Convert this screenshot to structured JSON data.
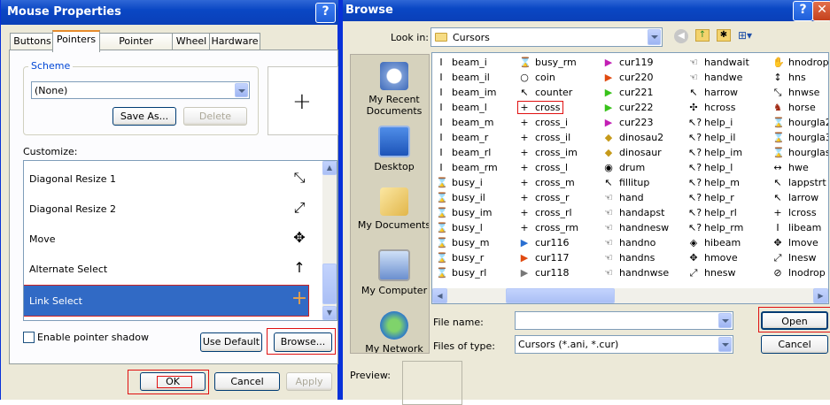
{
  "mouse": {
    "title": "Mouse Properties",
    "help_btn": "?",
    "tabs": [
      "Buttons",
      "Pointers",
      "Pointer Options",
      "Wheel",
      "Hardware"
    ],
    "scheme_label": "Scheme",
    "scheme_value": "(None)",
    "save_as": "Save As...",
    "delete": "Delete",
    "customize_label": "Customize:",
    "pointers": [
      {
        "label": "Diagonal Resize 1",
        "glyph": "⤡"
      },
      {
        "label": "Diagonal Resize 2",
        "glyph": "⤢"
      },
      {
        "label": "Move",
        "glyph": "✥"
      },
      {
        "label": "Alternate Select",
        "glyph": "↑"
      },
      {
        "label": "Link Select",
        "glyph": "+"
      }
    ],
    "shadow_label": "Enable pointer shadow",
    "use_default": "Use Default",
    "browse": "Browse...",
    "ok": "OK",
    "cancel": "Cancel",
    "apply": "Apply"
  },
  "browse": {
    "title": "Browse",
    "help_btn": "?",
    "close_btn": "✕",
    "look_in_label": "Look in:",
    "look_in_value": "Cursors",
    "places": [
      "My Recent Documents",
      "Desktop",
      "My Documents",
      "My Computer",
      "My Network"
    ],
    "col1": [
      "beam_i",
      "beam_il",
      "beam_im",
      "beam_l",
      "beam_m",
      "beam_r",
      "beam_rl",
      "beam_rm",
      "busy_i",
      "busy_il",
      "busy_im",
      "busy_l",
      "busy_m",
      "busy_r",
      "busy_rl"
    ],
    "col2": [
      "busy_rm",
      "coin",
      "counter",
      "cross",
      "cross_i",
      "cross_il",
      "cross_im",
      "cross_l",
      "cross_m",
      "cross_r",
      "cross_rl",
      "cross_rm",
      "cur116",
      "cur117",
      "cur118"
    ],
    "col3": [
      "cur119",
      "cur220",
      "cur221",
      "cur222",
      "cur223",
      "dinosau2",
      "dinosaur",
      "drum",
      "fillitup",
      "hand",
      "handapst",
      "handnesw",
      "handno",
      "handns",
      "handnwse"
    ],
    "col4": [
      "handwait",
      "handwe",
      "harrow",
      "hcross",
      "help_i",
      "help_il",
      "help_im",
      "help_l",
      "help_m",
      "help_r",
      "help_rl",
      "help_rm",
      "hibeam",
      "hmove",
      "hnesw"
    ],
    "col5": [
      "hnodrop",
      "hns",
      "hnwse",
      "horse",
      "hourgla2",
      "hourgla3",
      "hourglas",
      "hwe",
      "lappstrt",
      "larrow",
      "lcross",
      "libeam",
      "lmove",
      "lnesw",
      "lnodrop"
    ],
    "file_name_label": "File name:",
    "file_name_value": "",
    "files_of_type_label": "Files of type:",
    "files_of_type_value": "Cursors (*.ani, *.cur)",
    "open": "Open",
    "cancel": "Cancel",
    "preview_label": "Preview:"
  }
}
